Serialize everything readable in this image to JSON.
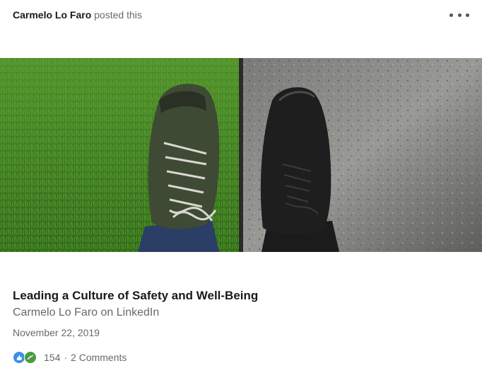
{
  "post": {
    "author": "Carmelo Lo Faro",
    "action": "posted this",
    "more_icon": "overflow-menu-icon"
  },
  "article": {
    "image": "green-grass-and-concrete-shoes-photo",
    "title": "Leading a Culture of Safety and Well-Being",
    "source": "Carmelo Lo Faro on LinkedIn",
    "date": "November 22, 2019"
  },
  "social": {
    "reactions": [
      "like-icon",
      "support-icon"
    ],
    "reaction_count": "154",
    "separator": "·",
    "comments": "2 Comments"
  },
  "colors": {
    "like": "#378fe9",
    "support": "#4a9a3f"
  }
}
